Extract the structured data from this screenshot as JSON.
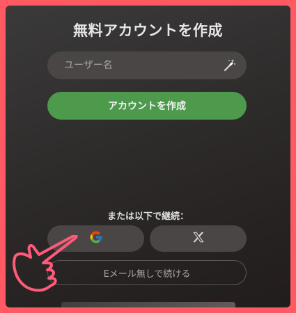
{
  "title": "無料アカウントを作成",
  "username": {
    "placeholder": "ユーザー名",
    "value": ""
  },
  "create_button_label": "アカウントを作成",
  "or_continue_label": "または以下で継続：",
  "social": {
    "google_icon": "google-g-icon",
    "x_icon": "x-logo-icon"
  },
  "email_button_label": "Eメール無しで続ける",
  "colors": {
    "background": "#ff5a64",
    "accent_green": "#4e9a4d",
    "field_bg": "#4a4646"
  }
}
